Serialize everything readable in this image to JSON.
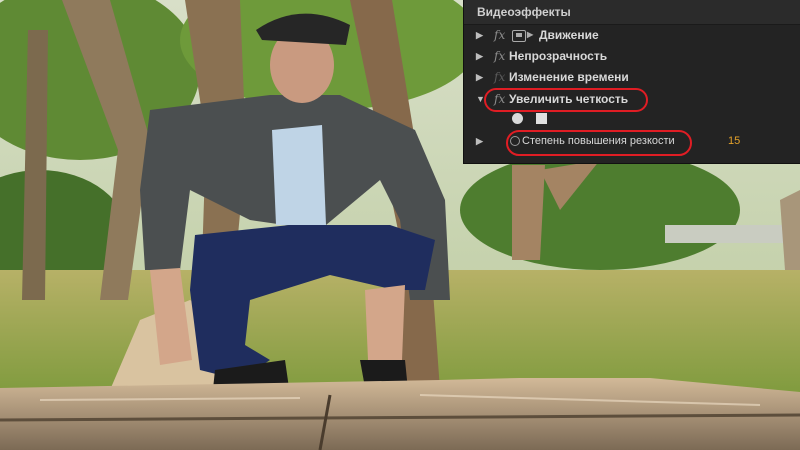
{
  "panel": {
    "title": "Видеоэффекты",
    "effects": [
      {
        "label": "Движение",
        "expanded": false,
        "icon": "fx-icon"
      },
      {
        "label": "Непрозрачность",
        "expanded": false,
        "icon": "fx-icon"
      },
      {
        "label": "Изменение времени",
        "expanded": false,
        "icon": "fx-icon"
      },
      {
        "label": "Увеличить четкость",
        "expanded": true,
        "icon": "fx-icon",
        "highlighted": true
      }
    ],
    "parameter": {
      "label": "Степень повышения резкости",
      "value": "15",
      "highlighted": true
    },
    "tools": [
      "ellipse-mask-icon",
      "rectangle-mask-icon"
    ]
  },
  "colors": {
    "panel_bg": "#232323",
    "highlight": "#e01d24",
    "value": "#e3a12a"
  }
}
